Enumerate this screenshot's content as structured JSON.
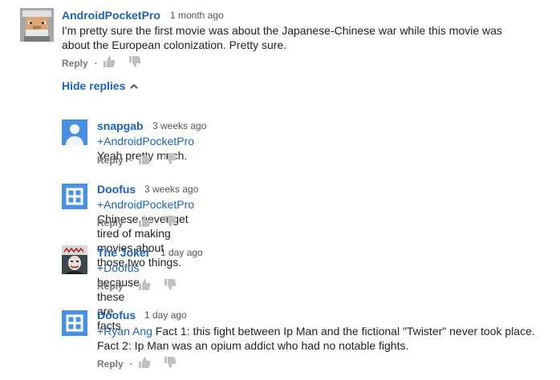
{
  "colors": {
    "link": "#1c62b9",
    "muted": "#767676",
    "icon": "#c0c0c0",
    "avatar_blue": "#4a90e2"
  },
  "top_comment": {
    "author": "AndroidPocketPro",
    "time": "1 month ago",
    "text_line1": "I'm pretty sure the first movie was about the Japanese-Chinese war while this movie was",
    "text_line2": "about the European colonization. Pretty sure.",
    "reply_label": "Reply",
    "separator": "·"
  },
  "hide_replies_label": "Hide replies",
  "replies": [
    {
      "author": "snapgab",
      "time": "3 weeks ago",
      "mention": "+AndroidPocketPro",
      "text": " Yeah pretty much.",
      "reply_label": "Reply",
      "separator": "·"
    },
    {
      "author": "Doofus",
      "time": "3 weeks ago",
      "mention": "+AndroidPocketPro",
      "text": " Chinese never get tired of making movies about those two things.",
      "reply_label": "Reply",
      "separator": "·"
    },
    {
      "author": "The Joker",
      "time": "1 day ago",
      "mention": "+Doofus",
      "text": " because these are facts",
      "reply_label": "Reply",
      "separator": "·"
    },
    {
      "author": "Doofus",
      "time": "1 day ago",
      "mention": "+Ryan Ang",
      "text_line1": " Fact 1: this fight between Ip Man and the fictional \"Twister\" never took place.",
      "text_line2": "Fact 2: Ip Man was an opium addict who had no notable fights.",
      "reply_label": "Reply",
      "separator": "·"
    }
  ]
}
